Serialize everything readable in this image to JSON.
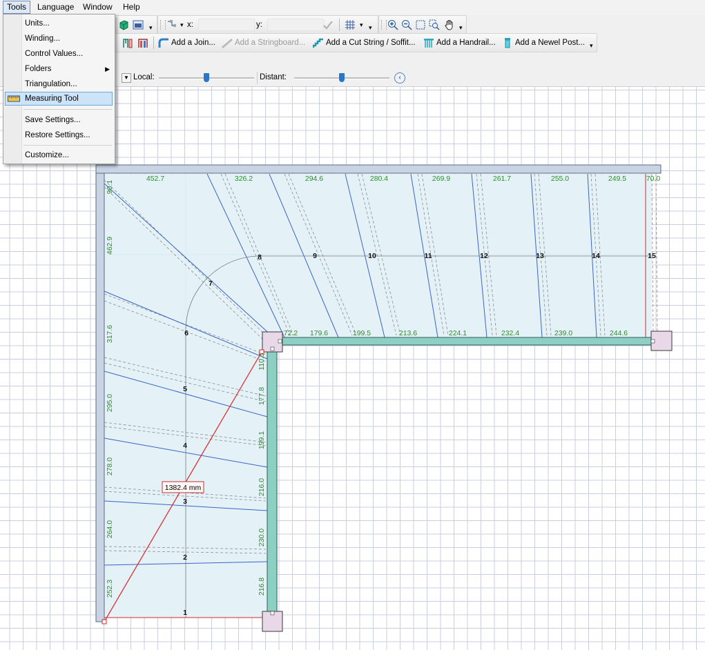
{
  "menubar": {
    "items": [
      "Tools",
      "Language",
      "Window",
      "Help"
    ]
  },
  "tools_menu": {
    "items": [
      {
        "label": "Units..."
      },
      {
        "label": "Winding..."
      },
      {
        "label": "Control Values..."
      },
      {
        "label": "Folders",
        "submenu": true
      },
      {
        "label": "Triangulation..."
      },
      {
        "label": "Measuring Tool",
        "selected": true
      },
      {
        "label": "Save Settings..."
      },
      {
        "label": "Restore Settings..."
      },
      {
        "label": "Customize..."
      }
    ]
  },
  "toolbar": {
    "x_label": "x:",
    "y_label": "y:",
    "add_join": "Add a Join...",
    "add_stringboard": "Add a Stringboard...",
    "add_cut_string": "Add a Cut String / Soffit...",
    "add_handrail": "Add a Handrail...",
    "add_newel_post": "Add a Newel Post..."
  },
  "view_bar": {
    "local_label": "Local:",
    "distant_label": "Distant:",
    "local_level": 0.5,
    "distant_level": 0.5
  },
  "drawing": {
    "measurement": "1382.4 mm",
    "steps": [
      "1",
      "2",
      "3",
      "4",
      "5",
      "6",
      "7",
      "8",
      "9",
      "10",
      "11",
      "12",
      "13",
      "14",
      "15"
    ],
    "top_widths": [
      "452.7",
      "326.2",
      "294.6",
      "280.4",
      "269.9",
      "261.7",
      "255.0",
      "249.5",
      "70.0"
    ],
    "inner_widths": [
      "72.2",
      "179.6",
      "199.5",
      "213.6",
      "224.1",
      "232.4",
      "239.0",
      "244.6"
    ],
    "left_widths": [
      "90.1",
      "462.9",
      "317.6",
      "295.0",
      "278.0",
      "264.0",
      "252.3"
    ],
    "right_widths": [
      "110.5",
      "177.8",
      "199.1",
      "216.0",
      "230.0",
      "216.8"
    ],
    "colors": {
      "fill": "#e4f2f8",
      "stringer": "#8ecfc4",
      "wall": "#c8d4e4",
      "post": "#e8d8e8",
      "tread_line": "#3b63c4",
      "dim_text": "#2e8b2e",
      "measure": "#e02020"
    }
  }
}
